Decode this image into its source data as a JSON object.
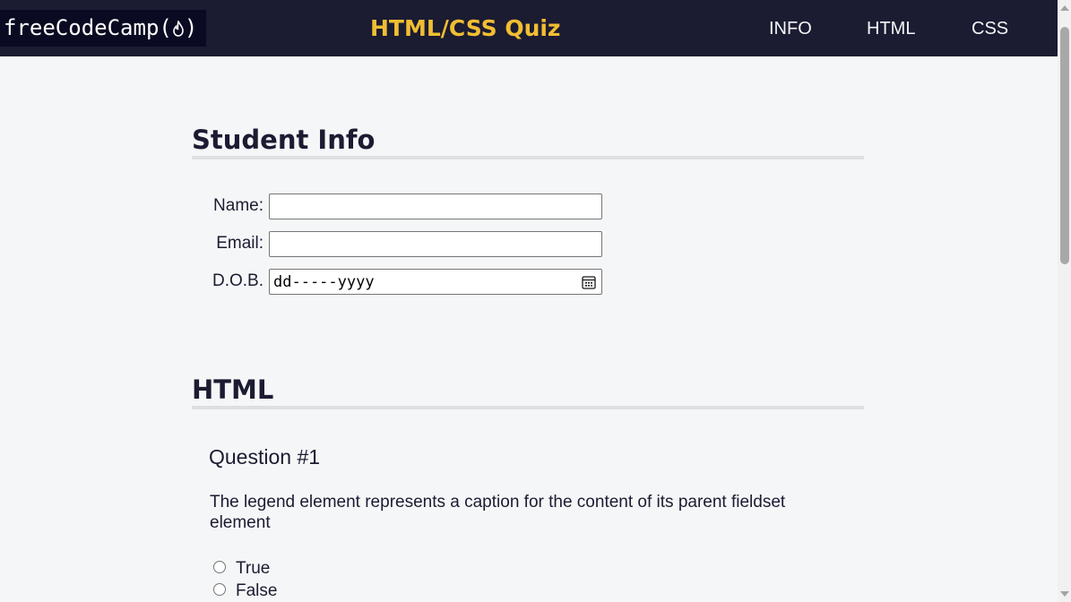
{
  "header": {
    "logo_text": "freeCodeCamp(",
    "logo_close": ")",
    "title": "HTML/CSS Quiz",
    "nav": [
      "INFO",
      "HTML",
      "CSS"
    ]
  },
  "student_info": {
    "title": "Student Info",
    "fields": [
      {
        "label": "Name:",
        "value": ""
      },
      {
        "label": "Email:",
        "value": ""
      },
      {
        "label": "D.O.B.",
        "placeholder": "dd-----yyyy"
      }
    ]
  },
  "html_section": {
    "title": "HTML",
    "question": {
      "title": "Question #1",
      "text": "The legend element represents a caption for the content of its parent fieldset element",
      "options": [
        "True",
        "False"
      ]
    }
  },
  "colors": {
    "nav_bg": "#1b1b32",
    "title_accent": "#f1be32",
    "page_bg": "#f5f6f7"
  }
}
